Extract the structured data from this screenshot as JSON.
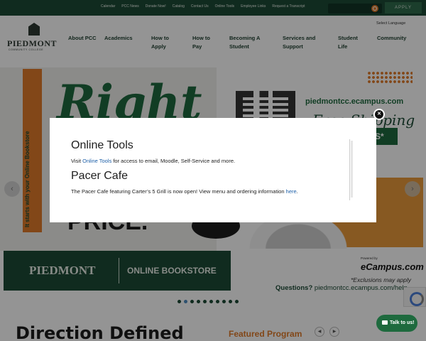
{
  "topbar": {
    "links": [
      "Calendar",
      "PCC News",
      "Donate Now!",
      "Catalog",
      "Contact Us",
      "Online Tools",
      "Employee Links",
      "Request a Transcript"
    ],
    "apply_label": "APPLY",
    "colors": {
      "bar": "#1d4b36",
      "accent": "#e07b2a"
    }
  },
  "header": {
    "logo_text": "PIEDMONT",
    "logo_sub": "COMMUNITY COLLEGE",
    "select_language": "Select Language",
    "nav": [
      "About PCC",
      "Academics",
      "How to Apply",
      "How to Pay",
      "Becoming A Student",
      "Services and Support",
      "Student Life",
      "Community"
    ]
  },
  "hero": {
    "vertical_text": "It starts with your Online Bookstore",
    "big_word": "Right",
    "price_word": "PRICE.",
    "url": "piedmontcc.ecampus.com",
    "free_shipping": "Free Shipping",
    "tag": "US*",
    "banner_logo": "PIEDMONT",
    "banner_label": "ONLINE BOOKSTORE",
    "powered_by": "Powered by",
    "ecampus": "eCampus.com",
    "exclusions": "*Exclusions may apply",
    "questions_label": "Questions?",
    "questions_url": "piedmontcc.ecampus.com/help",
    "prev_arrow": "‹",
    "next_arrow": "›",
    "slide_count": 10,
    "active_slide": 1
  },
  "modal": {
    "section1_title": "Online Tools",
    "section1_prefix": "Visit ",
    "section1_link": "Online Tools",
    "section1_suffix": " for access to email, Moodle, Self-Service and more.",
    "section2_title": "Pacer Cafe",
    "section2_prefix": "The Pacer Cafe featuring Carter’s 5 Grill is now open! View menu and ordering information ",
    "section2_link": "here",
    "section2_suffix": ".",
    "close_label": "✕"
  },
  "bottom": {
    "heading": "Direction Defined",
    "featured": "Featured Program",
    "prev": "◀",
    "next": "▶"
  },
  "chat": {
    "label": "Talk to us!"
  }
}
